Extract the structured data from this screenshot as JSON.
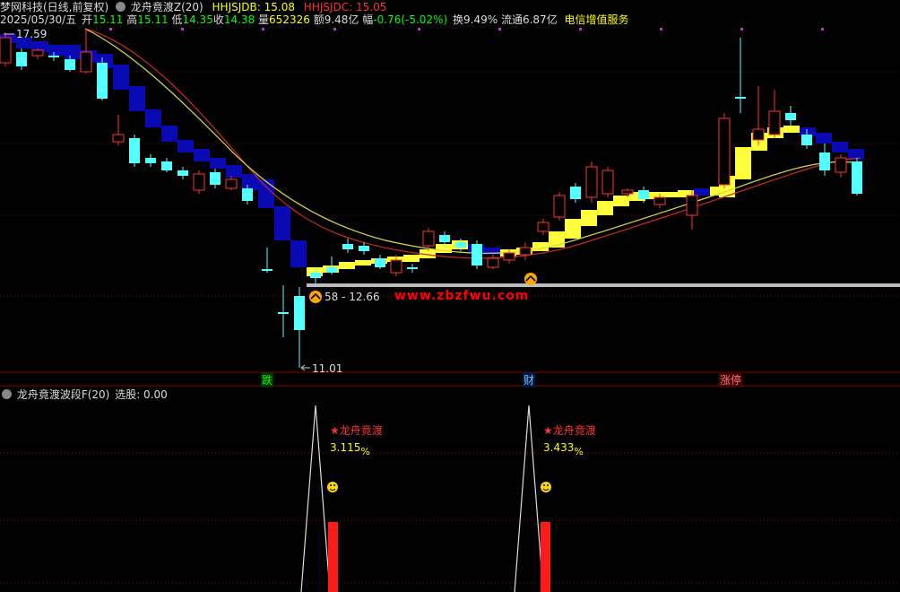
{
  "header1": {
    "title": "梦网科技(日线,前复权)",
    "indicator_name": "龙舟竟渡Z(20)",
    "hh_jsdb": "HHJSJDB: 15.08",
    "hh_jsdc": "HHJSJDC: 15.05"
  },
  "header2": {
    "date": "2025/05/30/五",
    "open_label": "开",
    "open": "15.11",
    "high_label": "高",
    "high": "15.11",
    "low_label": "低",
    "low": "14.35",
    "close_label": "收",
    "close": "14.38",
    "volume_label": "量",
    "volume": "652326",
    "amount_label": "额",
    "amount": "9.48亿",
    "change_label": "幅",
    "change": "-0.76(-5.02%)",
    "turnover_label": "换",
    "turnover": "9.49%",
    "float_label": "流通",
    "float": "6.87亿",
    "sector": "电信增值服务"
  },
  "price_labels": {
    "top": "17.59",
    "range": "58 - 12.66",
    "low": "11.01"
  },
  "watermark": "www.zbzfwu.com",
  "event_tags": [
    "跌",
    "财",
    "涨停"
  ],
  "lower_header": {
    "name": "龙舟竟渡波段F(20)",
    "pick": "选股: 0.00"
  },
  "signals": [
    {
      "label": "★龙舟竟渡",
      "value": "3.115",
      "unit": "%"
    },
    {
      "label": "★龙舟竟渡",
      "value": "3.433",
      "unit": "%"
    }
  ],
  "colors": {
    "up": "#ff3232",
    "down": "#54ffff",
    "ribbon_down": "#0a0ab4",
    "ribbon_up": "#ffff3c",
    "ma_yellow": "#d8d84a",
    "ma_red": "#c82828",
    "header_yellow": "#ffff00",
    "header_red": "#ff3232",
    "header_green": "#00ff00",
    "watermark": "#ff0000"
  },
  "icons": [
    "up-arrow-circle-icon",
    "smiley-icon",
    "dropdown-icon"
  ]
}
